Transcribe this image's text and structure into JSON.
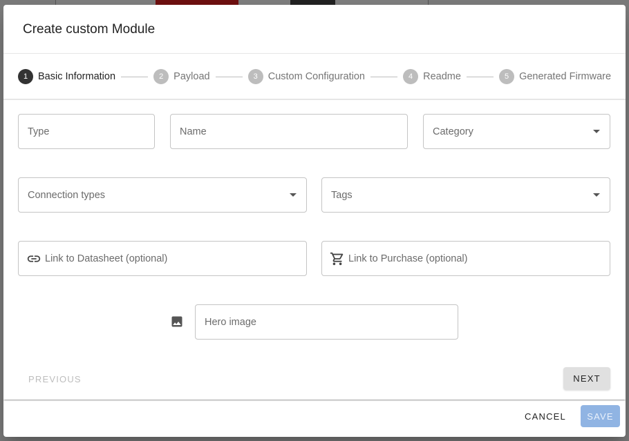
{
  "dialog": {
    "title": "Create custom Module"
  },
  "stepper": {
    "steps": [
      {
        "number": "1",
        "label": "Basic Information",
        "active": true
      },
      {
        "number": "2",
        "label": "Payload",
        "active": false
      },
      {
        "number": "3",
        "label": "Custom Configuration",
        "active": false
      },
      {
        "number": "4",
        "label": "Readme",
        "active": false
      },
      {
        "number": "5",
        "label": "Generated Firmware",
        "active": false
      }
    ]
  },
  "form": {
    "type": {
      "placeholder": "Type",
      "value": ""
    },
    "name": {
      "placeholder": "Name",
      "value": ""
    },
    "category": {
      "placeholder": "Category",
      "value": ""
    },
    "connection_types": {
      "placeholder": "Connection types",
      "value": ""
    },
    "tags": {
      "placeholder": "Tags",
      "value": ""
    },
    "datasheet_link": {
      "placeholder": "Link to Datasheet (optional)",
      "value": "",
      "icon": "link-icon"
    },
    "purchase_link": {
      "placeholder": "Link to Purchase (optional)",
      "value": "",
      "icon": "cart-icon"
    },
    "hero_image": {
      "placeholder": "Hero image",
      "value": "",
      "icon": "image-icon"
    }
  },
  "navigation": {
    "previous_label": "PREVIOUS",
    "next_label": "NEXT"
  },
  "actions": {
    "cancel_label": "CANCEL",
    "save_label": "SAVE"
  },
  "colors": {
    "active_step": "#333333",
    "inactive_step": "#bdbdbd",
    "save_button": "#90b4e3"
  }
}
